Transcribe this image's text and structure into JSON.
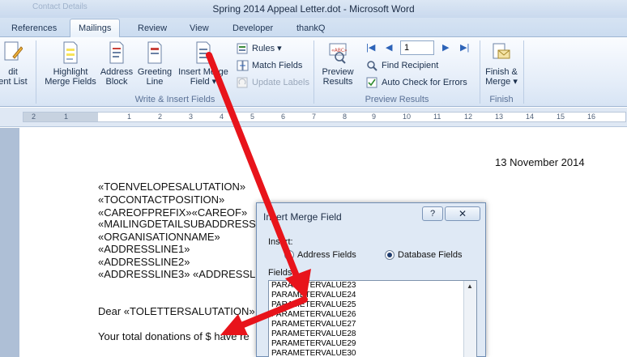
{
  "window": {
    "title": "Spring 2014 Appeal Letter.dot - Microsoft Word",
    "qat_ghost": "Contact Details"
  },
  "tabs": [
    {
      "label": "References",
      "active": false
    },
    {
      "label": "Mailings",
      "active": true
    },
    {
      "label": "Review",
      "active": false
    },
    {
      "label": "View",
      "active": false
    },
    {
      "label": "Developer",
      "active": false
    },
    {
      "label": "thankQ",
      "active": false
    }
  ],
  "ribbon": {
    "edit_list": {
      "line1": "dit",
      "line2": "ent List"
    },
    "highlight": {
      "line1": "Highlight",
      "line2": "Merge Fields"
    },
    "address_block": {
      "line1": "Address",
      "line2": "Block"
    },
    "greeting_line": {
      "line1": "Greeting",
      "line2": "Line"
    },
    "insert_merge": {
      "line1": "Insert Merge",
      "line2": "Field ▾"
    },
    "rules": "Rules ▾",
    "match_fields": "Match Fields",
    "update_labels": "Update Labels",
    "group_write_insert": "Write & Insert Fields",
    "preview_results": {
      "line1": "Preview",
      "line2": "Results"
    },
    "record_number": "1",
    "find_recipient": "Find Recipient",
    "auto_check": "Auto Check for Errors",
    "group_preview": "Preview Results",
    "finish_merge": {
      "line1": "Finish &",
      "line2": "Merge ▾"
    },
    "group_finish": "Finish"
  },
  "ruler": {
    "numbers": [
      "2",
      "1",
      "1",
      "2",
      "3",
      "4",
      "5",
      "6",
      "7",
      "8",
      "9",
      "10",
      "11",
      "12",
      "13",
      "14",
      "15",
      "16"
    ]
  },
  "document": {
    "date": "13 November 2014",
    "fields": [
      "«TOENVELOPESALUTATION»",
      "«TOCONTACTPOSITION»",
      "«CAREOFPREFIX»«CAREOF»",
      "«MAILINGDETAILSUBADDRESS",
      "«ORGANISATIONNAME»",
      "«ADDRESSLINE1»",
      "«ADDRESSLINE2»",
      "«ADDRESSLINE3»  «ADDRESSL"
    ],
    "salutation": "Dear «TOLETTERSALUTATION»",
    "body": "Your total donations of $ have re"
  },
  "dialog": {
    "title": "Insert Merge Field",
    "help": "?",
    "close": "✕",
    "insert_label": "Insert:",
    "option_address": "Address Fields",
    "option_database": "Database Fields",
    "fields_label": "Fields:",
    "fields": [
      "PARAMETERVALUE23",
      "PARAMETERVALUE24",
      "PARAMETERVALUE25",
      "PARAMETERVALUE26",
      "PARAMETERVALUE27",
      "PARAMETERVALUE28",
      "PARAMETERVALUE29",
      "PARAMETERVALUE30"
    ]
  },
  "colors": {
    "arrow": "#e8141b",
    "ribbon_text": "#1a2f4c"
  }
}
